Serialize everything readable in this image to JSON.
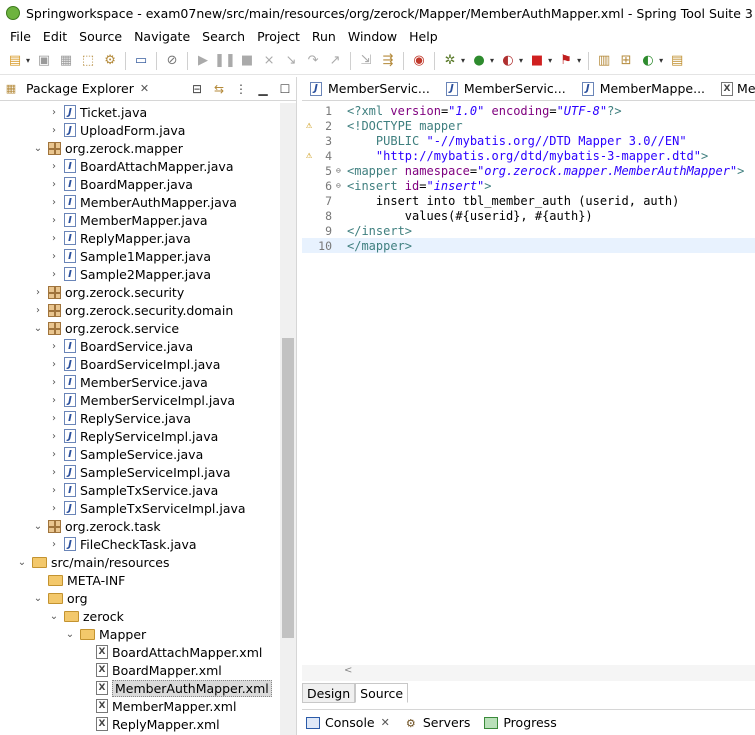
{
  "window": {
    "title": "Springworkspace - exam07new/src/main/resources/org/zerock/Mapper/MemberAuthMapper.xml - Spring Tool Suite 3"
  },
  "menu": [
    "File",
    "Edit",
    "Source",
    "Navigate",
    "Search",
    "Project",
    "Run",
    "Window",
    "Help"
  ],
  "package_explorer": {
    "title": "Package Explorer",
    "close": "✕",
    "tree": [
      {
        "level": 3,
        "icon": "java-file",
        "twisty": ">",
        "label": "Ticket.java"
      },
      {
        "level": 3,
        "icon": "java-file",
        "twisty": ">",
        "label": "UploadForm.java"
      },
      {
        "level": 2,
        "icon": "package",
        "twisty": "v",
        "label": "org.zerock.mapper"
      },
      {
        "level": 3,
        "icon": "java-interface",
        "twisty": ">",
        "label": "BoardAttachMapper.java"
      },
      {
        "level": 3,
        "icon": "java-interface",
        "twisty": ">",
        "label": "BoardMapper.java"
      },
      {
        "level": 3,
        "icon": "java-interface",
        "twisty": ">",
        "label": "MemberAuthMapper.java"
      },
      {
        "level": 3,
        "icon": "java-interface",
        "twisty": ">",
        "label": "MemberMapper.java"
      },
      {
        "level": 3,
        "icon": "java-interface",
        "twisty": ">",
        "label": "ReplyMapper.java"
      },
      {
        "level": 3,
        "icon": "java-interface",
        "twisty": ">",
        "label": "Sample1Mapper.java"
      },
      {
        "level": 3,
        "icon": "java-interface",
        "twisty": ">",
        "label": "Sample2Mapper.java"
      },
      {
        "level": 2,
        "icon": "package",
        "twisty": ">",
        "label": "org.zerock.security"
      },
      {
        "level": 2,
        "icon": "package",
        "twisty": ">",
        "label": "org.zerock.security.domain"
      },
      {
        "level": 2,
        "icon": "package",
        "twisty": "v",
        "label": "org.zerock.service"
      },
      {
        "level": 3,
        "icon": "java-interface",
        "twisty": ">",
        "label": "BoardService.java"
      },
      {
        "level": 3,
        "icon": "java-class",
        "twisty": ">",
        "label": "BoardServiceImpl.java"
      },
      {
        "level": 3,
        "icon": "java-interface",
        "twisty": ">",
        "label": "MemberService.java"
      },
      {
        "level": 3,
        "icon": "java-class",
        "twisty": ">",
        "label": "MemberServiceImpl.java"
      },
      {
        "level": 3,
        "icon": "java-interface",
        "twisty": ">",
        "label": "ReplyService.java"
      },
      {
        "level": 3,
        "icon": "java-class",
        "twisty": ">",
        "label": "ReplyServiceImpl.java"
      },
      {
        "level": 3,
        "icon": "java-interface",
        "twisty": ">",
        "label": "SampleService.java"
      },
      {
        "level": 3,
        "icon": "java-class",
        "twisty": ">",
        "label": "SampleServiceImpl.java"
      },
      {
        "level": 3,
        "icon": "java-interface",
        "twisty": ">",
        "label": "SampleTxService.java"
      },
      {
        "level": 3,
        "icon": "java-class",
        "twisty": ">",
        "label": "SampleTxServiceImpl.java"
      },
      {
        "level": 2,
        "icon": "package",
        "twisty": "v",
        "label": "org.zerock.task"
      },
      {
        "level": 3,
        "icon": "java-class",
        "twisty": ">",
        "label": "FileCheckTask.java"
      },
      {
        "level": 1,
        "icon": "source-folder",
        "twisty": "v",
        "label": "src/main/resources"
      },
      {
        "level": 2,
        "icon": "folder",
        "twisty": "",
        "label": "META-INF"
      },
      {
        "level": 2,
        "icon": "folder",
        "twisty": "v",
        "label": "org"
      },
      {
        "level": 3,
        "icon": "folder",
        "twisty": "v",
        "label": "zerock"
      },
      {
        "level": 4,
        "icon": "folder",
        "twisty": "v",
        "label": "Mapper"
      },
      {
        "level": 5,
        "icon": "xml-file",
        "twisty": "",
        "label": "BoardAttachMapper.xml"
      },
      {
        "level": 5,
        "icon": "xml-file",
        "twisty": "",
        "label": "BoardMapper.xml"
      },
      {
        "level": 5,
        "icon": "xml-file",
        "twisty": "",
        "label": "MemberAuthMapper.xml",
        "selected": true
      },
      {
        "level": 5,
        "icon": "xml-file",
        "twisty": "",
        "label": "MemberMapper.xml"
      },
      {
        "level": 5,
        "icon": "xml-file",
        "twisty": "",
        "label": "ReplyMapper.xml"
      }
    ]
  },
  "editor": {
    "tabs": [
      "MemberServic...",
      "MemberServic...",
      "MemberMappe...",
      "Me"
    ],
    "lines": [
      {
        "n": "1",
        "marker": "",
        "fold": "",
        "tokens": [
          [
            "tag",
            "<?xml "
          ],
          [
            "attr",
            "version"
          ],
          [
            "txt",
            "="
          ],
          [
            "val",
            "\"1.0\""
          ],
          [
            "txt",
            " "
          ],
          [
            "attr",
            "encoding"
          ],
          [
            "txt",
            "="
          ],
          [
            "val",
            "\"UTF-8\""
          ],
          [
            "tag",
            "?>"
          ]
        ]
      },
      {
        "n": "2",
        "marker": "warn",
        "fold": "",
        "tokens": [
          [
            "tag",
            "<!DOCTYPE mapper"
          ]
        ]
      },
      {
        "n": "3",
        "marker": "",
        "fold": "",
        "tokens": [
          [
            "tag",
            "    PUBLIC "
          ],
          [
            "str",
            "\"-//mybatis.org//DTD Mapper 3.0//EN\""
          ]
        ]
      },
      {
        "n": "4",
        "marker": "warn",
        "fold": "",
        "tokens": [
          [
            "str",
            "    \"http://mybatis.org/dtd/mybatis-3-mapper.dtd\""
          ],
          [
            "tag",
            ">"
          ]
        ]
      },
      {
        "n": "5",
        "marker": "",
        "fold": "⊖",
        "tokens": [
          [
            "tag",
            "<mapper "
          ],
          [
            "attr",
            "namespace"
          ],
          [
            "txt",
            "="
          ],
          [
            "val",
            "\"org.zerock.mapper.MemberAuthMapper\""
          ],
          [
            "tag",
            ">"
          ]
        ]
      },
      {
        "n": "6",
        "marker": "",
        "fold": "⊖",
        "tokens": [
          [
            "tag",
            "<insert "
          ],
          [
            "attr",
            "id"
          ],
          [
            "txt",
            "="
          ],
          [
            "val",
            "\"insert\""
          ],
          [
            "tag",
            ">"
          ]
        ]
      },
      {
        "n": "7",
        "marker": "",
        "fold": "",
        "tokens": [
          [
            "txt",
            "    insert into tbl_member_auth (userid, auth)"
          ]
        ]
      },
      {
        "n": "8",
        "marker": "",
        "fold": "",
        "tokens": [
          [
            "txt",
            "        values(#{userid}, #{auth})"
          ]
        ]
      },
      {
        "n": "9",
        "marker": "",
        "fold": "",
        "tokens": [
          [
            "tag",
            "</insert>"
          ]
        ]
      },
      {
        "n": "10",
        "marker": "",
        "fold": "",
        "current": true,
        "tokens": [
          [
            "tag",
            "</mapper>"
          ]
        ]
      }
    ],
    "bottom_tabs": [
      "Design",
      "Source"
    ],
    "scroll_left": "<"
  },
  "bottom_views": [
    {
      "label": "Console",
      "icon": "console-icon",
      "close": "✕"
    },
    {
      "label": "Servers",
      "icon": "servers-icon"
    },
    {
      "label": "Progress",
      "icon": "progress-icon"
    }
  ]
}
